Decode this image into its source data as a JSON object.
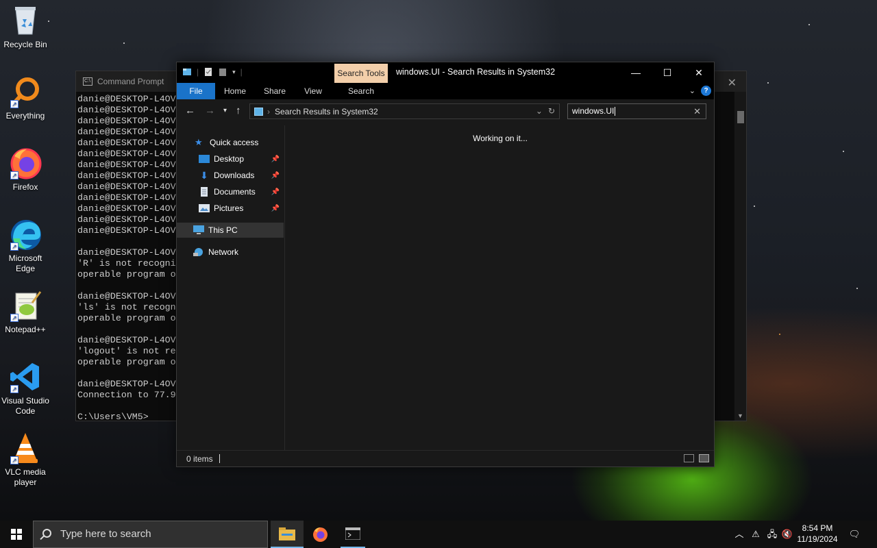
{
  "desktop": {
    "icons": [
      {
        "label": "Recycle Bin",
        "icon": "recycle-bin-icon"
      },
      {
        "label": "Everything",
        "icon": "everything-icon"
      },
      {
        "label": "Firefox",
        "icon": "firefox-icon"
      },
      {
        "label": "Microsoft Edge",
        "icon": "edge-icon"
      },
      {
        "label": "Notepad++",
        "icon": "notepadpp-icon"
      },
      {
        "label": "Visual Studio Code",
        "icon": "vscode-icon"
      },
      {
        "label": "VLC media player",
        "icon": "vlc-icon"
      }
    ]
  },
  "cmd": {
    "title": "Command Prompt",
    "lines": [
      "danie@DESKTOP-L4OV",
      "danie@DESKTOP-L4OV",
      "danie@DESKTOP-L4OV",
      "danie@DESKTOP-L4OV",
      "danie@DESKTOP-L4OV",
      "danie@DESKTOP-L4OV",
      "danie@DESKTOP-L4OV",
      "danie@DESKTOP-L4OV",
      "danie@DESKTOP-L4OV",
      "danie@DESKTOP-L4OV",
      "danie@DESKTOP-L4OV",
      "danie@DESKTOP-L4OV",
      "danie@DESKTOP-L4OV",
      "",
      "danie@DESKTOP-L4OV",
      "'R' is not recogni",
      "operable program o",
      "",
      "danie@DESKTOP-L4OV",
      "'ls' is not recogn",
      "operable program o",
      "",
      "danie@DESKTOP-L4OV",
      "'logout' is not re",
      "operable program o",
      "",
      "danie@DESKTOP-L4OV",
      "Connection to 77.9",
      "",
      "C:\\Users\\VM5>"
    ]
  },
  "explorer": {
    "title": "windows.UI - Search Results in System32",
    "contextual_tab": "Search Tools",
    "ribbon_tabs": [
      "File",
      "Home",
      "Share",
      "View",
      "Search"
    ],
    "address": "Search Results in System32",
    "search_value": "windows.UI",
    "nav": {
      "quick_access": "Quick access",
      "desktop": "Desktop",
      "downloads": "Downloads",
      "documents": "Documents",
      "pictures": "Pictures",
      "this_pc": "This PC",
      "network": "Network"
    },
    "status_text": "Working on it...",
    "item_count": "0 items"
  },
  "taskbar": {
    "search_placeholder": "Type here to search",
    "time": "8:54 PM",
    "date": "11/19/2024"
  }
}
